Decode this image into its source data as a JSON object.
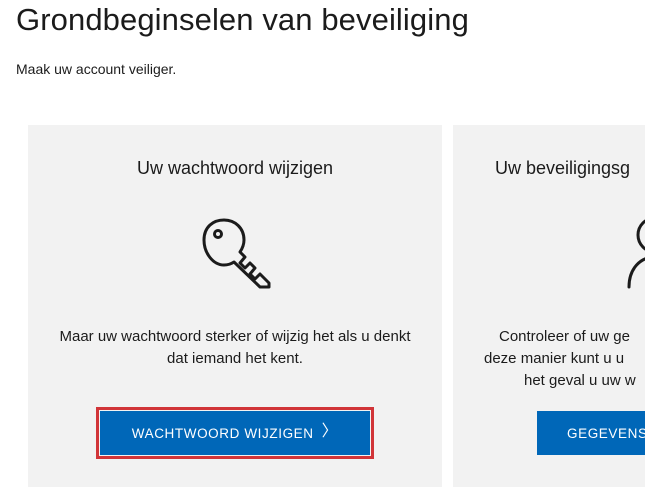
{
  "header": {
    "title": "Grondbeginselen van beveiliging",
    "subtitle": "Maak uw account veiliger."
  },
  "cards": [
    {
      "heading": "Uw wachtwoord wijzigen",
      "icon": "key-icon",
      "description": "Maar uw wachtwoord sterker of wijzig het als u denkt dat iemand het kent.",
      "button_label": "WACHTWOORD WIJZIGEN",
      "button_chevron": "〉"
    },
    {
      "heading": "Uw beveiligingsg",
      "icon": "person-icon",
      "description_lines": [
        "Controleer of uw ge",
        "deze manier kunt u u",
        "het geval u uw w"
      ],
      "button_label": "GEGEVENS"
    }
  ],
  "colors": {
    "accent": "#0067b8",
    "highlight": "#d13438",
    "card_background": "#f2f2f2"
  }
}
